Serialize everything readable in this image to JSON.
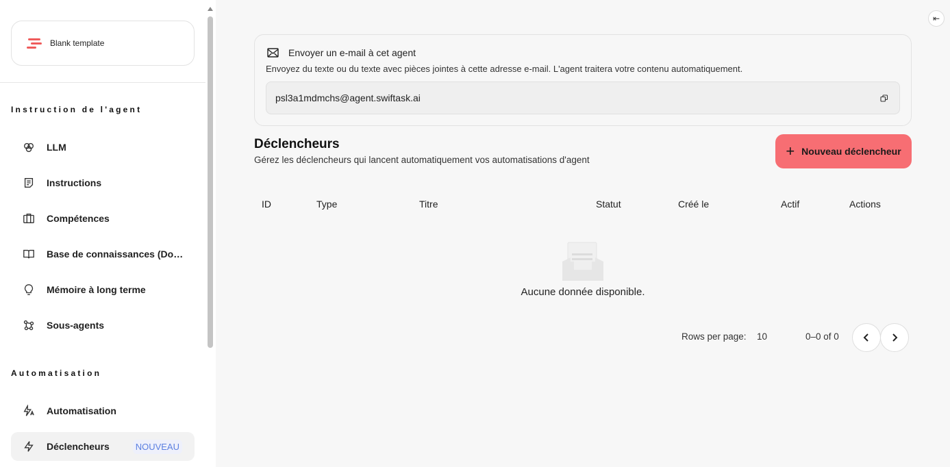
{
  "sidebar": {
    "template_label": "Blank template",
    "sections": {
      "instruction_title": "Instruction de l'agent",
      "automation_title": "Automatisation"
    },
    "items": [
      {
        "label": "LLM",
        "icon": "brain-icon"
      },
      {
        "label": "Instructions",
        "icon": "document-icon"
      },
      {
        "label": "Compétences",
        "icon": "briefcase-icon"
      },
      {
        "label": "Base de connaissances (Données)",
        "icon": "book-icon"
      },
      {
        "label": "Mémoire à long terme",
        "icon": "lightbulb-icon"
      },
      {
        "label": "Sous-agents",
        "icon": "network-icon"
      },
      {
        "label": "Automatisation",
        "icon": "auto-lightning-icon"
      },
      {
        "label": "Déclencheurs",
        "icon": "lightning-icon",
        "badge": "NOUVEAU",
        "active": true
      }
    ],
    "accent_color": "#ef5b5b"
  },
  "email": {
    "title": "Envoyer un e-mail à cet agent",
    "description": "Envoyez du texte ou du texte avec pièces jointes à cette adresse e-mail. L'agent traitera votre contenu automatiquement.",
    "address": "psl3a1mdmchs@agent.swiftask.ai"
  },
  "triggers": {
    "title": "Déclencheurs",
    "subtitle": "Gérez les déclencheurs qui lancent automatiquement vos automatisations d'agent",
    "new_button": "Nouveau déclencheur",
    "button_color": "#f76e73",
    "columns": [
      "ID",
      "Type",
      "Titre",
      "Statut",
      "Créé le",
      "Actif",
      "Actions"
    ],
    "empty_text": "Aucune donnée disponible."
  },
  "pagination": {
    "rows_label": "Rows per page:",
    "rows_value": "10",
    "range": "0–0 of 0"
  }
}
